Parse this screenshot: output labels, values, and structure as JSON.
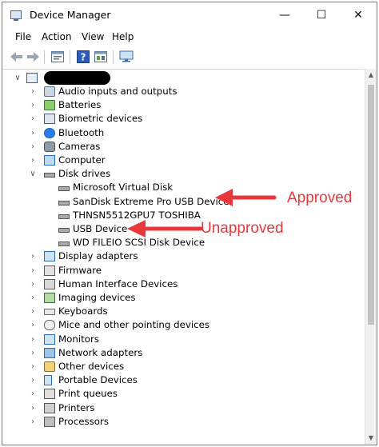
{
  "window": {
    "title": "Device Manager",
    "minimize": "—",
    "maximize": "☐",
    "close": "✕"
  },
  "menu": [
    "File",
    "Action",
    "View",
    "Help"
  ],
  "toolbar": [
    "back-icon",
    "forward-icon",
    "properties-icon",
    "help-icon",
    "view-icon",
    "monitor-icon"
  ],
  "tree": [
    {
      "label": "Audio inputs and outputs",
      "icon": "speaker-icon"
    },
    {
      "label": "Batteries",
      "icon": "battery-icon"
    },
    {
      "label": "Biometric devices",
      "icon": "biometric-icon"
    },
    {
      "label": "Bluetooth",
      "icon": "bluetooth-icon"
    },
    {
      "label": "Cameras",
      "icon": "camera-icon"
    },
    {
      "label": "Computer",
      "icon": "computer-icon"
    },
    {
      "label": "Disk drives",
      "icon": "disk-icon",
      "expanded": true
    },
    {
      "label": "Microsoft Virtual Disk",
      "icon": "disk-icon",
      "child": true
    },
    {
      "label": "SanDisk Extreme Pro USB Device",
      "icon": "disk-icon",
      "child": true
    },
    {
      "label": "THNSN5512GPU7 TOSHIBA",
      "icon": "disk-icon",
      "child": true
    },
    {
      "label": "USB Device",
      "icon": "disk-icon",
      "child": true
    },
    {
      "label": "WD FILEIO SCSI Disk Device",
      "icon": "disk-icon",
      "child": true
    },
    {
      "label": "Display adapters",
      "icon": "display-icon"
    },
    {
      "label": "Firmware",
      "icon": "firmware-icon"
    },
    {
      "label": "Human Interface Devices",
      "icon": "hid-icon"
    },
    {
      "label": "Imaging devices",
      "icon": "imaging-icon"
    },
    {
      "label": "Keyboards",
      "icon": "keyboard-icon"
    },
    {
      "label": "Mice and other pointing devices",
      "icon": "mouse-icon"
    },
    {
      "label": "Monitors",
      "icon": "monitor-icon"
    },
    {
      "label": "Network adapters",
      "icon": "network-icon"
    },
    {
      "label": "Other devices",
      "icon": "other-icon"
    },
    {
      "label": "Portable Devices",
      "icon": "portable-icon"
    },
    {
      "label": "Print queues",
      "icon": "print-icon"
    },
    {
      "label": "Printers",
      "icon": "printer-icon"
    },
    {
      "label": "Processors",
      "icon": "processor-icon"
    }
  ],
  "annotations": {
    "approved": "Approved",
    "unapproved": "Unapproved",
    "color": "#e8383c"
  }
}
